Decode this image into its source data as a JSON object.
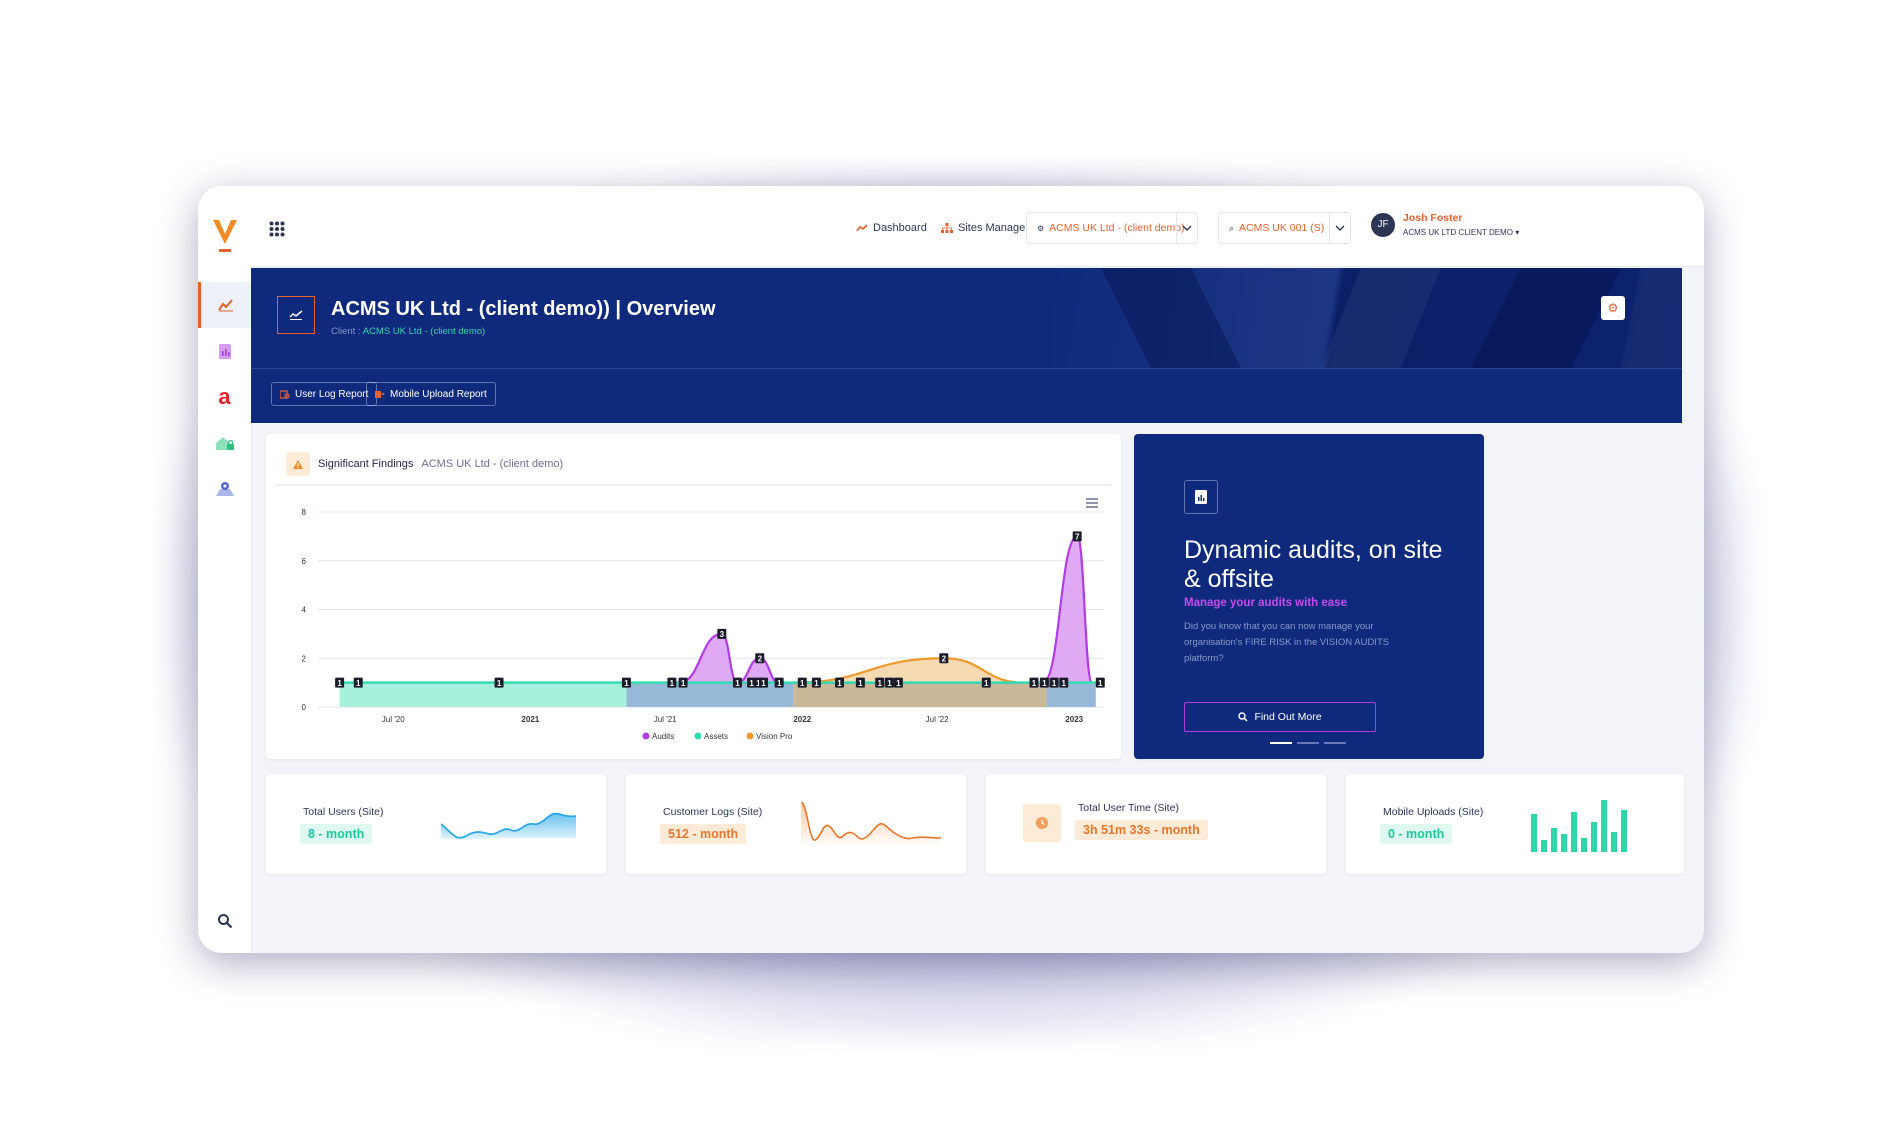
{
  "topbar": {
    "nav_dashboard": "Dashboard",
    "nav_sites_manager": "Sites Manager",
    "client_select": "ACMS UK Ltd - (client demo)",
    "site_select": "ACMS UK 001 (S)",
    "user_initials": "JF",
    "user_name": "Josh Foster",
    "user_org": "ACMS UK LTD CLIENT DEMO"
  },
  "banner": {
    "title": "ACMS UK Ltd - (client demo)) | Overview",
    "client_label": "Client :",
    "client_name": "ACMS UK Ltd - (client demo)",
    "btn_user_log": "User Log Report",
    "btn_mobile_upload": "Mobile Upload Report"
  },
  "findings": {
    "title": "Significant Findings",
    "subtitle": "ACMS UK Ltd - (client demo)"
  },
  "chart_data": {
    "type": "area",
    "ylim": [
      0,
      8
    ],
    "yticks": [
      0,
      2,
      4,
      6,
      8
    ],
    "xticks": [
      "Jul '20",
      "2021",
      "Jul '21",
      "2022",
      "Jul '22",
      "2023"
    ],
    "grid": true,
    "legend_position": "bottom",
    "series": [
      {
        "name": "Audits",
        "color": "#b13ce6",
        "fill": "#dba0f2",
        "points": [
          [
            "2021-07-20",
            1
          ],
          [
            "2021-09-15",
            3
          ],
          [
            "2021-10-06",
            1
          ],
          [
            "2021-11-05",
            2
          ],
          [
            "2021-12-01",
            1
          ],
          [
            "2022-11-20",
            1
          ],
          [
            "2023-01-05",
            7
          ],
          [
            "2023-01-25",
            1
          ]
        ]
      },
      {
        "name": "Assets",
        "color": "#33dcb0",
        "fill": "#a6f0dc",
        "points": [
          [
            "2020-04-20",
            1
          ],
          [
            "2023-01-30",
            1
          ]
        ]
      },
      {
        "name": "Vision Pro",
        "color": "#ee9a2e",
        "fill": "#f5d6a8",
        "points": [
          [
            "2021-12-20",
            1
          ],
          [
            "2022-07-10",
            2
          ],
          [
            "2022-10-25",
            1
          ]
        ]
      }
    ],
    "data_labels": [
      [
        "2020-04-20",
        1
      ],
      [
        "2020-05-15",
        1
      ],
      [
        "2020-11-20",
        1
      ],
      [
        "2021-05-10",
        1
      ],
      [
        "2021-07-10",
        1
      ],
      [
        "2021-07-25",
        1
      ],
      [
        "2021-09-15",
        3
      ],
      [
        "2021-10-06",
        1
      ],
      [
        "2021-10-25",
        1
      ],
      [
        "2021-11-03",
        1
      ],
      [
        "2021-11-10",
        1
      ],
      [
        "2021-11-05",
        2
      ],
      [
        "2021-12-01",
        1
      ],
      [
        "2022-01-01",
        1
      ],
      [
        "2022-01-20",
        1
      ],
      [
        "2022-02-20",
        1
      ],
      [
        "2022-03-20",
        1
      ],
      [
        "2022-04-15",
        1
      ],
      [
        "2022-04-28",
        1
      ],
      [
        "2022-05-10",
        1
      ],
      [
        "2022-07-10",
        2
      ],
      [
        "2022-09-05",
        1
      ],
      [
        "2022-11-08",
        1
      ],
      [
        "2022-11-22",
        1
      ],
      [
        "2022-12-05",
        1
      ],
      [
        "2022-12-18",
        1
      ],
      [
        "2023-01-05",
        7
      ],
      [
        "2023-02-05",
        1
      ]
    ]
  },
  "promo": {
    "title": "Dynamic audits, on site & offsite",
    "subtitle": "Manage your audits with ease",
    "text": "Did you know that you can now manage your organisation's FIRE RISK in the VISION AUDITS platform?",
    "button": "Find Out More"
  },
  "stats": [
    {
      "label": "Total Users (Site)",
      "value": "8 - month",
      "color": "#1fc9a0",
      "bg": "#dff8f0"
    },
    {
      "label": "Customer Logs (Site)",
      "value": "512 - month",
      "color": "#e8762c",
      "bg": "#fdebd8"
    },
    {
      "label": "Total User Time (Site)",
      "value": "3h 51m 33s - month",
      "color": "#e8762c",
      "bg": "#fdebd8"
    },
    {
      "label": "Mobile Uploads (Site)",
      "value": "0 - month",
      "color": "#1fc9a0",
      "bg": "#dff8f0"
    }
  ],
  "icons": {
    "rail": [
      "analytics-icon",
      "document-icon",
      "a-brand-icon",
      "secure-home-icon",
      "map-pin-icon",
      "search-icon"
    ],
    "topbar": [
      "apps-grid-icon",
      "chart-icon",
      "sitemap-icon",
      "chevron-down-icon"
    ]
  }
}
